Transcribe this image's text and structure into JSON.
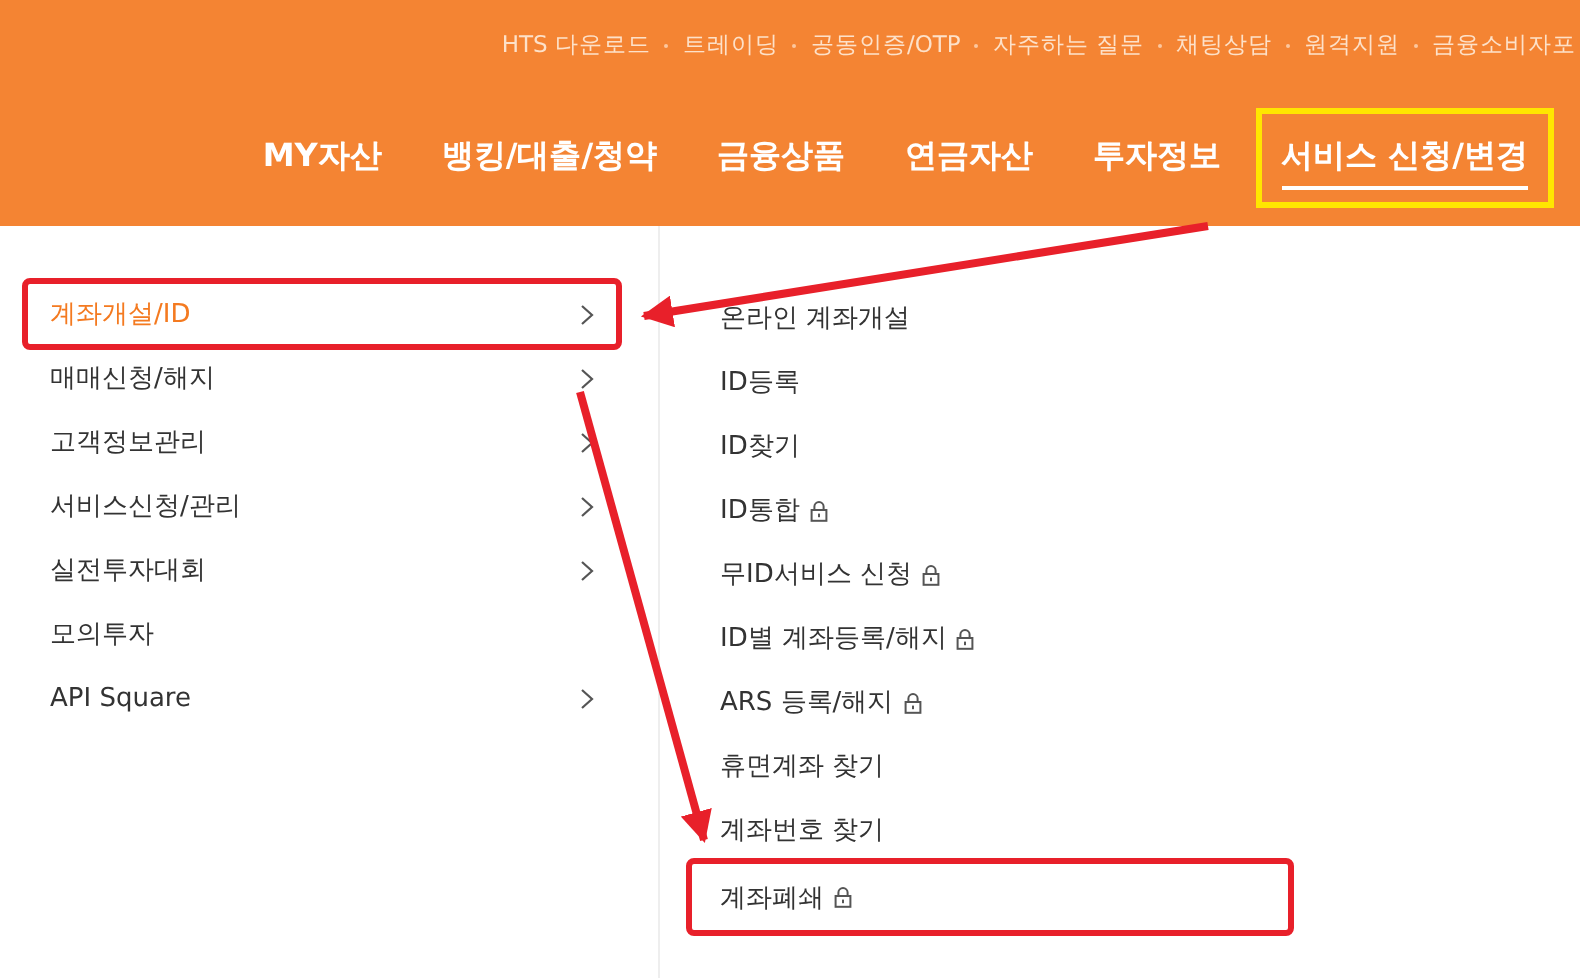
{
  "utility_links": [
    "HTS 다운로드",
    "트레이딩",
    "공동인증/OTP",
    "자주하는 질문",
    "채팅상담",
    "원격지원",
    "금융소비자포"
  ],
  "nav": [
    {
      "label": "MY자산",
      "selected": false,
      "highlighted": false
    },
    {
      "label": "뱅킹/대출/청약",
      "selected": false,
      "highlighted": false
    },
    {
      "label": "금융상품",
      "selected": false,
      "highlighted": false
    },
    {
      "label": "연금자산",
      "selected": false,
      "highlighted": false
    },
    {
      "label": "투자정보",
      "selected": false,
      "highlighted": false
    },
    {
      "label": "서비스 신청/변경",
      "selected": true,
      "highlighted": true
    }
  ],
  "menu": [
    {
      "label": "계좌개설/ID",
      "selected": true,
      "has_submenu": true,
      "highlighted": true
    },
    {
      "label": "매매신청/해지",
      "selected": false,
      "has_submenu": true,
      "highlighted": false
    },
    {
      "label": "고객정보관리",
      "selected": false,
      "has_submenu": true,
      "highlighted": false
    },
    {
      "label": "서비스신청/관리",
      "selected": false,
      "has_submenu": true,
      "highlighted": false
    },
    {
      "label": "실전투자대회",
      "selected": false,
      "has_submenu": true,
      "highlighted": false
    },
    {
      "label": "모의투자",
      "selected": false,
      "has_submenu": false,
      "highlighted": false
    },
    {
      "label": "API Square",
      "selected": false,
      "has_submenu": true,
      "highlighted": false
    }
  ],
  "submenu": [
    {
      "label": "온라인 계좌개설",
      "locked": false,
      "highlighted": false
    },
    {
      "label": "ID등록",
      "locked": false,
      "highlighted": false
    },
    {
      "label": "ID찾기",
      "locked": false,
      "highlighted": false
    },
    {
      "label": "ID통합",
      "locked": true,
      "highlighted": false
    },
    {
      "label": "무ID서비스 신청",
      "locked": true,
      "highlighted": false
    },
    {
      "label": "ID별 계좌등록/해지",
      "locked": true,
      "highlighted": false
    },
    {
      "label": "ARS 등록/해지",
      "locked": true,
      "highlighted": false
    },
    {
      "label": "휴면계좌 찾기",
      "locked": false,
      "highlighted": false
    },
    {
      "label": "계좌번호 찾기",
      "locked": false,
      "highlighted": false
    },
    {
      "label": "계좌폐쇄",
      "locked": true,
      "highlighted": true
    }
  ]
}
